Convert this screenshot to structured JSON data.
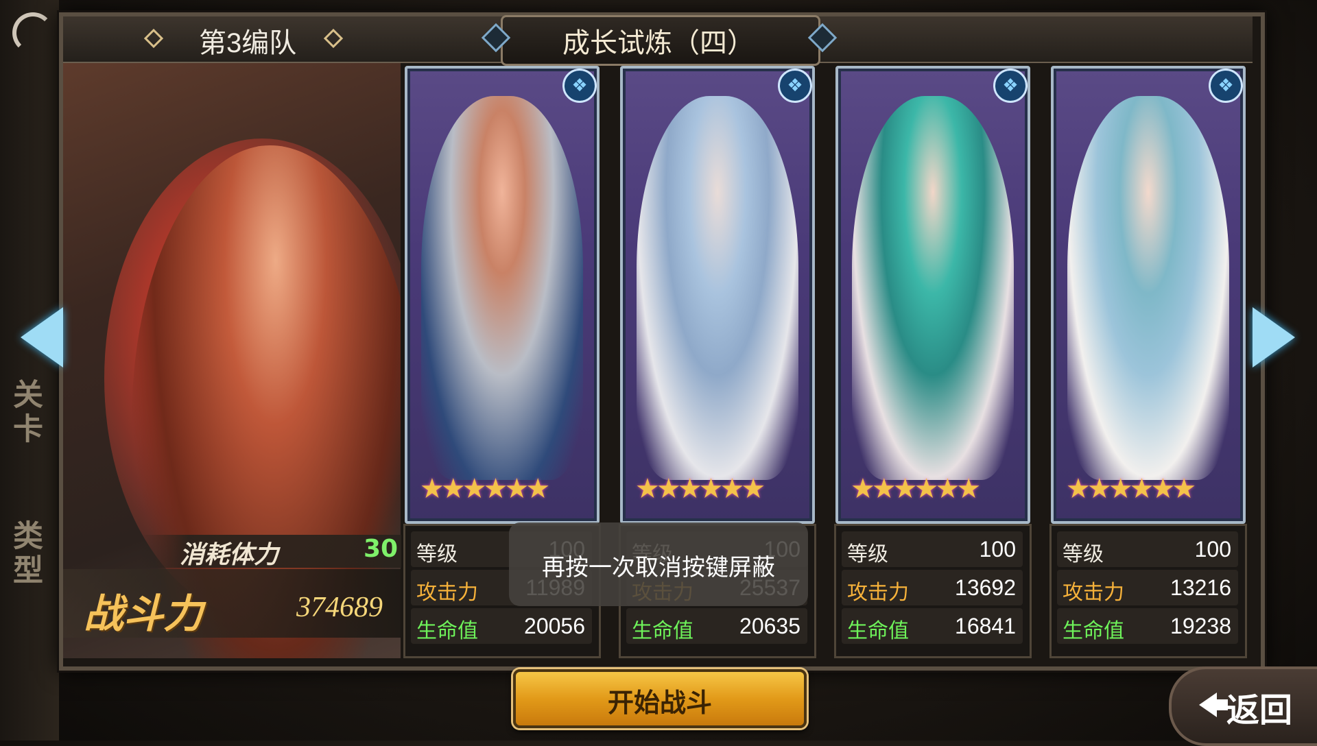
{
  "header": {
    "team_name": "第3编队",
    "stage_name": "成长试炼（四）"
  },
  "side_menu": {
    "item1": "关卡",
    "item2": "类型"
  },
  "leader": {
    "stamina_label": "消耗体力",
    "stamina_value": "30",
    "power_label": "战斗力",
    "power_value": "374689"
  },
  "stat_labels": {
    "level": "等级",
    "attack": "攻击力",
    "hp": "生命值"
  },
  "cards": [
    {
      "element": "water",
      "stars": 6,
      "level": "100",
      "attack": "11989",
      "hp": "20056"
    },
    {
      "element": "water",
      "stars": 6,
      "level": "100",
      "attack": "25537",
      "hp": "20635"
    },
    {
      "element": "water",
      "stars": 6,
      "level": "100",
      "attack": "13692",
      "hp": "16841"
    },
    {
      "element": "water",
      "stars": 6,
      "level": "100",
      "attack": "13216",
      "hp": "19238"
    }
  ],
  "toast": "再按一次取消按键屏蔽",
  "buttons": {
    "start": "开始战斗",
    "back": "返回"
  },
  "colors": {
    "attack_label": "#f7b23a",
    "hp_label": "#6ef35a",
    "stamina_value": "#7ff06a",
    "power_label": "#f6c25a",
    "start_button": "#e29a19",
    "element_water": "#8ad3ff"
  }
}
